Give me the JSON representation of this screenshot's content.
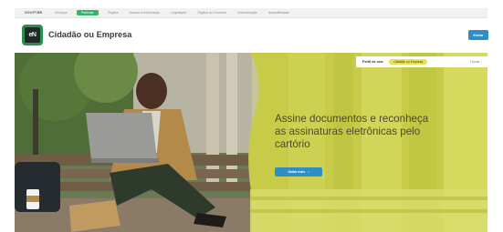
{
  "gov_bar": {
    "brand": "GOV.PT.BR",
    "items": [
      "Serviços",
      "Participe",
      "Órgãos",
      "Acesso à informação",
      "Legislação",
      "Órgãos do Governo",
      "Comunicação",
      "Acessibilidade"
    ]
  },
  "header": {
    "logo_text": "eN",
    "site_title": "Cidadão ou Empresa",
    "enter_label": "Entrar"
  },
  "hero": {
    "profile_label": "Perfil de uso:",
    "profile_value": "Cidadão ou Empresa",
    "profile_toggle": "Trocar ↓",
    "headline": "Assine documentos e reconheça as assinaturas eletrônicas pelo cartório",
    "cta_label": "Saiba mais",
    "cta_arrow": "›"
  },
  "colors": {
    "accent_green": "#35b36b",
    "primary_blue": "#2d8fc4",
    "highlight_yellow": "#e9e24a",
    "hero_olive": "#c9cc4a"
  }
}
